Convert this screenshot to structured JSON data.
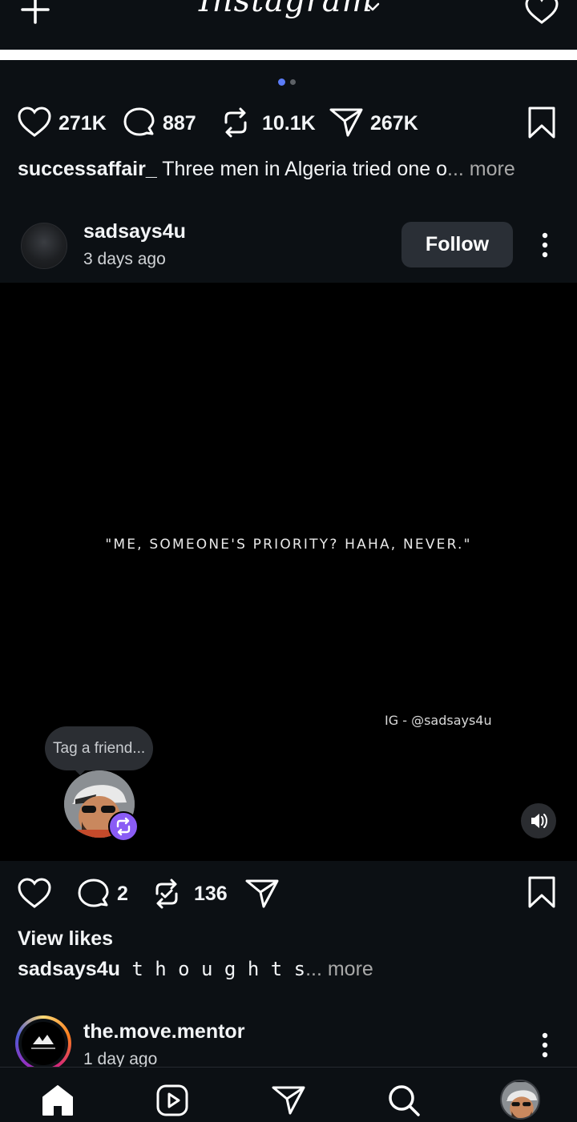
{
  "header": {
    "logo": "Instagram"
  },
  "post1": {
    "counts": {
      "likes": "271K",
      "comments": "887",
      "reposts": "10.1K",
      "shares": "267K"
    },
    "caption_user": "successaffair_",
    "caption_text": " Three men in Algeria tried one o",
    "caption_more": "... more"
  },
  "post2": {
    "username": "sadsays4u",
    "time": "3 days ago",
    "follow_label": "Follow",
    "quote": "\"ME, SOMEONE'S PRIORITY? HAHA, NEVER.\"",
    "watermark": "IG - @sadsays4u",
    "tag_prompt": "Tag a friend...",
    "counts": {
      "comments": "2",
      "reposts": "136"
    },
    "view_likes": "View likes",
    "caption_user": "sadsays4u",
    "caption_text": " t h o u g h t s",
    "caption_more": "... more"
  },
  "post3": {
    "username": "the.move.mentor",
    "time": "1 day ago"
  },
  "colors": {
    "background": "#0c1014",
    "accent_dot": "#5b7cf7",
    "repost_badge": "#8a5cf5",
    "follow_bg": "#2a2f36"
  },
  "icons": [
    "plus-icon",
    "chevron-down-icon",
    "heart-icon",
    "comment-icon",
    "repost-icon",
    "send-icon",
    "bookmark-icon",
    "more-icon",
    "sound-icon",
    "home-icon",
    "reels-icon",
    "search-icon"
  ]
}
